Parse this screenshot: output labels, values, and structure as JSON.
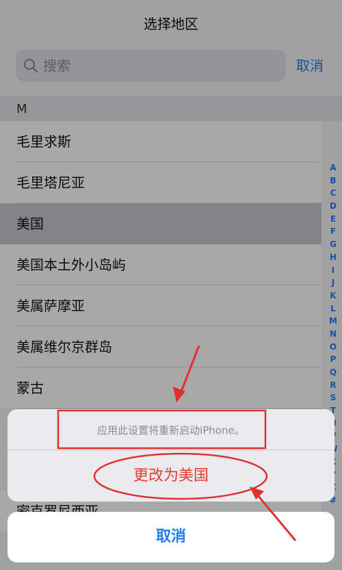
{
  "nav": {
    "title": "选择地区"
  },
  "search": {
    "placeholder": "搜索",
    "cancel_label": "取消"
  },
  "section": {
    "letter": "M"
  },
  "rows": [
    {
      "label": "毛里求斯",
      "selected": false
    },
    {
      "label": "毛里塔尼亚",
      "selected": false
    },
    {
      "label": "美国",
      "selected": true
    },
    {
      "label": "美国本土外小岛屿",
      "selected": false
    },
    {
      "label": "美属萨摩亚",
      "selected": false
    },
    {
      "label": "美属维尔京群岛",
      "selected": false
    },
    {
      "label": "蒙古",
      "selected": false
    },
    {
      "label": "密克罗尼西亚",
      "selected": false
    }
  ],
  "index_letters": [
    "A",
    "B",
    "C",
    "D",
    "E",
    "F",
    "G",
    "H",
    "I",
    "J",
    "K",
    "L",
    "M",
    "N",
    "O",
    "P",
    "Q",
    "R",
    "S",
    "T",
    "U",
    "V",
    "W",
    "X",
    "Y",
    "Z",
    "#"
  ],
  "sheet": {
    "message": "应用此设置将重新启动iPhone。",
    "action_label": "更改为美国",
    "cancel_label": "取消"
  },
  "colors": {
    "accent": "#1e7cf5",
    "destructive": "#e53b2f",
    "annotation": "#e03030"
  },
  "icons": {
    "search": "magnifier-icon"
  }
}
